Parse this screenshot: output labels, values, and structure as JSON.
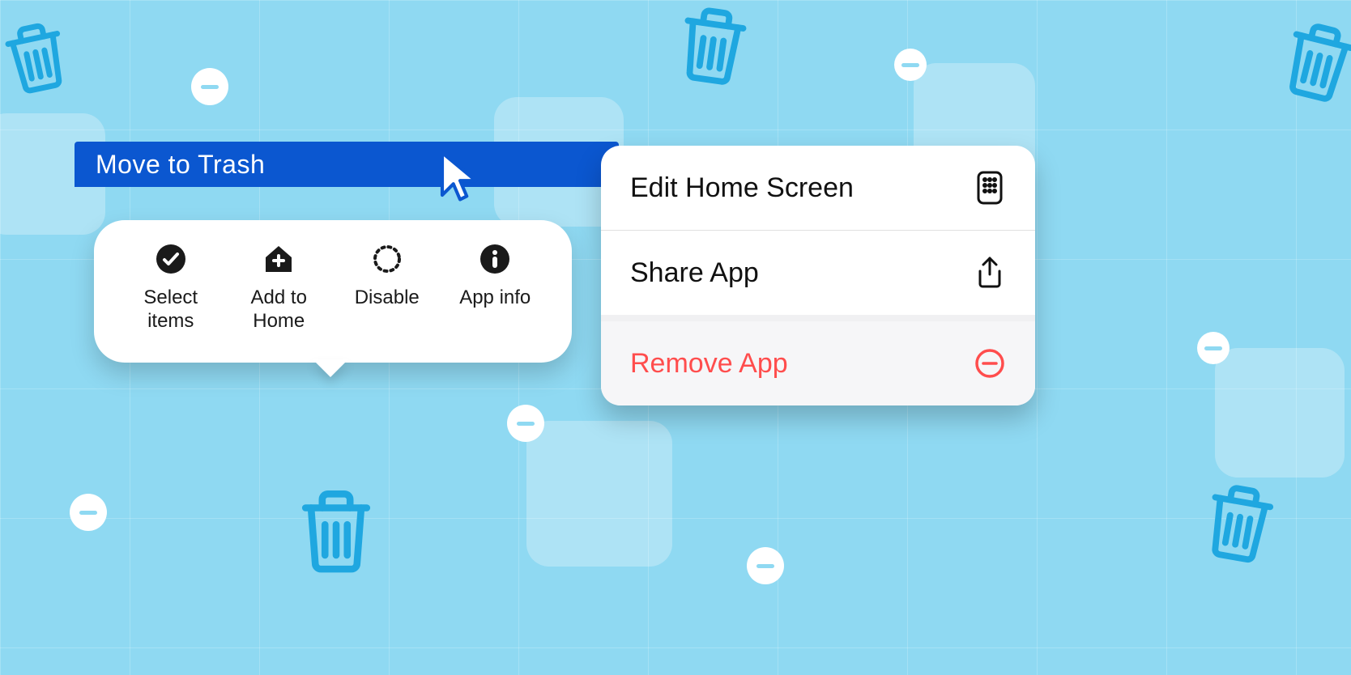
{
  "moveBar": {
    "label": "Move to Trash"
  },
  "androidActions": [
    {
      "label": "Select items",
      "icon": "check-circle-icon"
    },
    {
      "label": "Add to Home",
      "icon": "home-plus-icon"
    },
    {
      "label": "Disable",
      "icon": "dotted-circle-icon"
    },
    {
      "label": "App info",
      "icon": "info-icon"
    }
  ],
  "iosMenu": [
    {
      "label": "Edit Home Screen",
      "icon": "phone-grid-icon",
      "danger": false
    },
    {
      "label": "Share App",
      "icon": "share-icon",
      "danger": false
    },
    {
      "label": "Remove App",
      "icon": "minus-circle-icon",
      "danger": true
    }
  ],
  "colors": {
    "accent": "#0b57d0",
    "danger": "#ff4d4d",
    "bg": "#8fd9f2"
  }
}
